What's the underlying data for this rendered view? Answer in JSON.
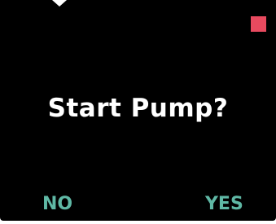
{
  "screen": {
    "prompt": "Start Pump?",
    "status_indicator_color": "#e84a5f"
  },
  "soft_keys": {
    "left_label": "NO",
    "right_label": "YES",
    "color": "#5fb8a5"
  }
}
